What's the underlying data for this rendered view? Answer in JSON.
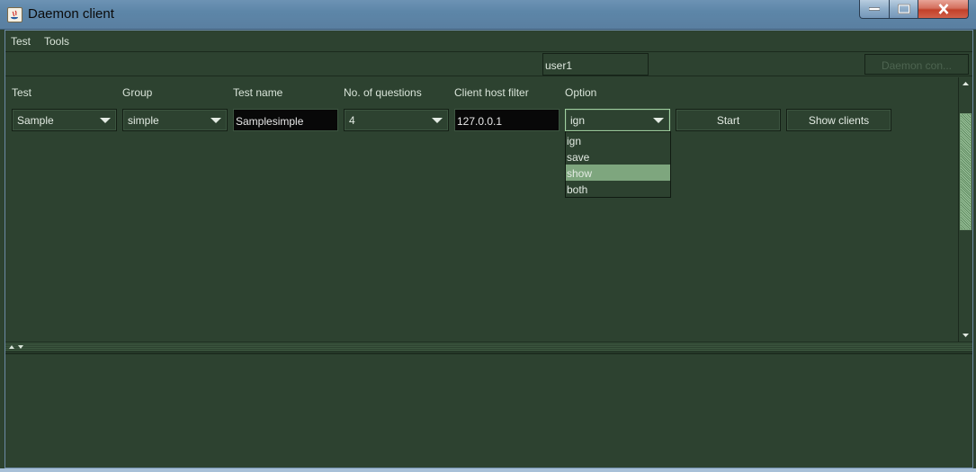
{
  "window": {
    "title": "Daemon client",
    "icon": "java-icon",
    "controls": [
      "minimize-icon",
      "maximize-icon",
      "close-icon"
    ]
  },
  "menu": {
    "items": [
      "Test",
      "Tools"
    ]
  },
  "toolbar": {
    "user": "user1",
    "daemon_button": "Daemon con..."
  },
  "form": {
    "labels": {
      "test": "Test",
      "group": "Group",
      "test_name": "Test name",
      "questions": "No. of questions",
      "host_filter": "Client host filter",
      "option": "Option"
    },
    "values": {
      "test": "Sample",
      "group": "simple",
      "test_name": "Samplesimple",
      "questions": "4",
      "host_filter": "127.0.0.1",
      "option": "ign"
    },
    "buttons": {
      "start": "Start",
      "show_clients": "Show clients"
    },
    "option_dropdown": {
      "items": [
        "ign",
        "save",
        "show",
        "both"
      ],
      "highlighted": "show"
    }
  },
  "colors": {
    "background": "#2d4230",
    "highlight": "#7ea67e",
    "text": "#e3ebe3"
  }
}
